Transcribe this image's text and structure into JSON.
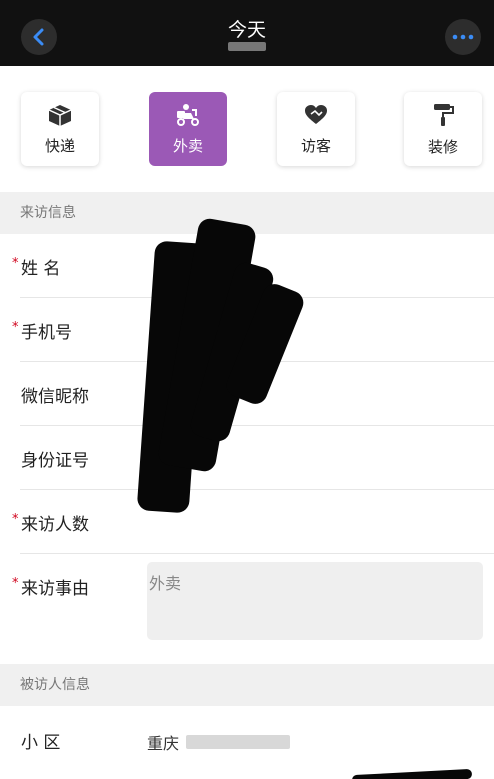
{
  "header": {
    "title": "今天",
    "back_icon": "chevron-left-icon",
    "more_icon": "more-dots-icon"
  },
  "visit_types": [
    {
      "label": "快递",
      "icon": "package-icon",
      "active": false
    },
    {
      "label": "外卖",
      "icon": "delivery-scooter-icon",
      "active": true
    },
    {
      "label": "访客",
      "icon": "heart-handshake-icon",
      "active": false
    },
    {
      "label": "装修",
      "icon": "paint-roller-icon",
      "active": false
    }
  ],
  "colors": {
    "accent": "#9b59b6",
    "required": "#d0021b",
    "header_bg": "#111111"
  },
  "visitor_section": {
    "title": "来访信息",
    "fields": [
      {
        "label": "姓 名",
        "required": true
      },
      {
        "label": "手机号",
        "required": true
      },
      {
        "label": "微信昵称",
        "required": false
      },
      {
        "label": "身份证号",
        "required": false
      },
      {
        "label": "来访人数",
        "required": true
      },
      {
        "label": "来访事由",
        "required": true,
        "value": "外卖"
      }
    ]
  },
  "host_section": {
    "title": "被访人信息",
    "fields": [
      {
        "label": "小 区",
        "value": "重庆"
      }
    ]
  }
}
